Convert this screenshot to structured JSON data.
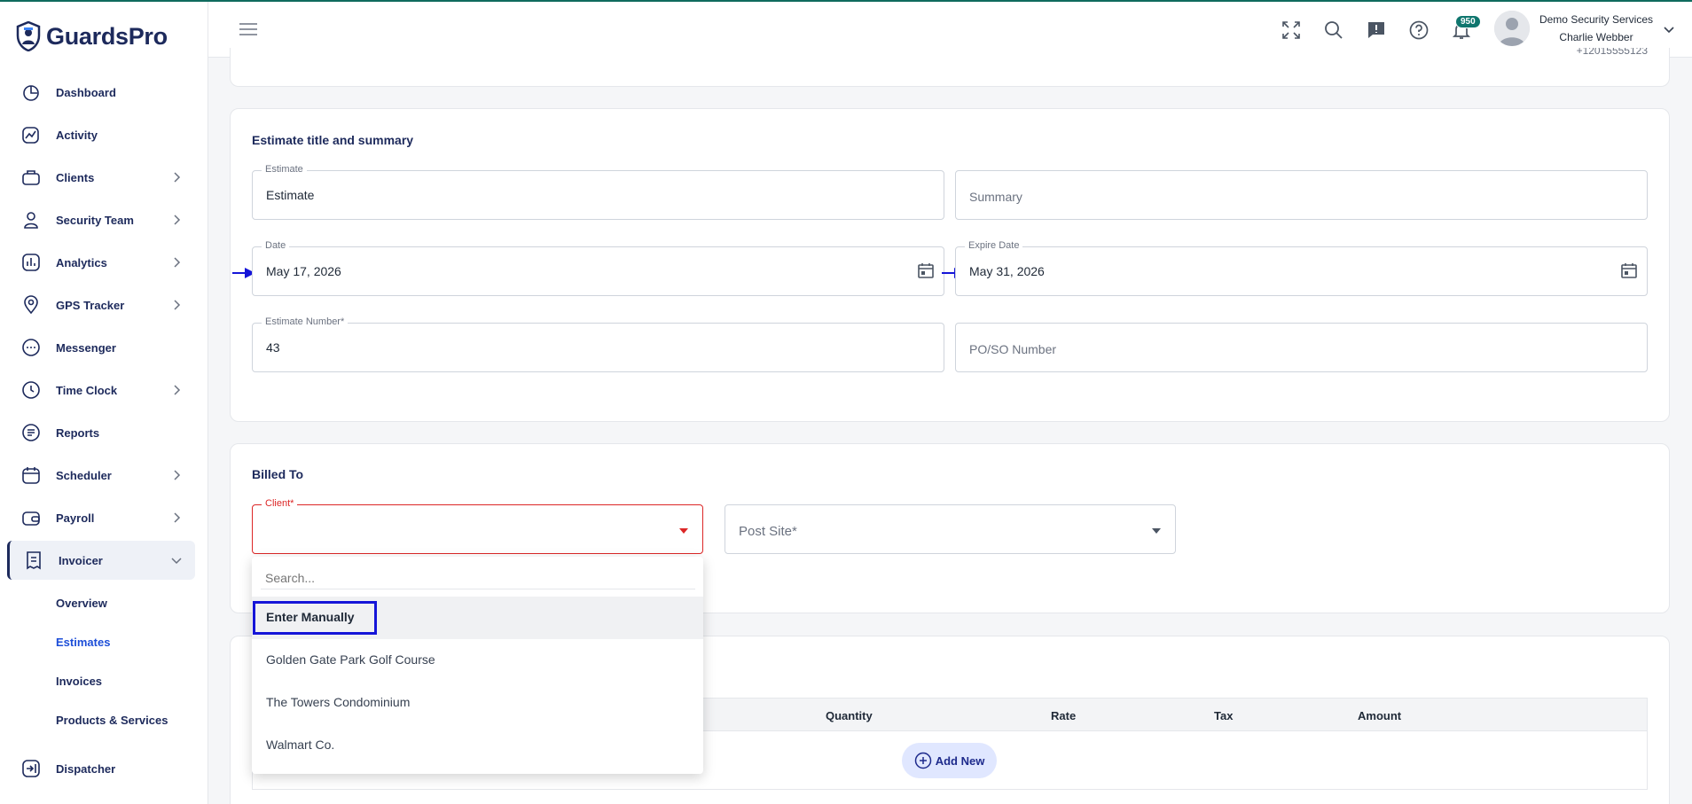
{
  "app": {
    "name": "GuardsPro"
  },
  "sidebar": {
    "items": [
      {
        "label": "Dashboard",
        "icon": "dashboard-icon"
      },
      {
        "label": "Activity",
        "icon": "activity-icon"
      },
      {
        "label": "Clients",
        "icon": "clients-icon"
      },
      {
        "label": "Security Team",
        "icon": "security-team-icon"
      },
      {
        "label": "Analytics",
        "icon": "analytics-icon"
      },
      {
        "label": "GPS Tracker",
        "icon": "gps-pin-icon"
      },
      {
        "label": "Messenger",
        "icon": "messenger-icon"
      },
      {
        "label": "Time Clock",
        "icon": "clock-icon"
      },
      {
        "label": "Reports",
        "icon": "reports-icon"
      },
      {
        "label": "Scheduler",
        "icon": "calendar-icon"
      },
      {
        "label": "Payroll",
        "icon": "wallet-icon"
      },
      {
        "label": "Invoicer",
        "icon": "invoice-icon"
      },
      {
        "label": "Dispatcher",
        "icon": "dispatcher-icon"
      }
    ],
    "invoicer_sub": [
      {
        "label": "Overview"
      },
      {
        "label": "Estimates"
      },
      {
        "label": "Invoices"
      },
      {
        "label": "Products & Services"
      }
    ]
  },
  "header": {
    "notification_count": "950",
    "user_company": "Demo Security Services",
    "user_name": "Charlie Webber"
  },
  "top_card": {
    "partial_text": "+12015555123"
  },
  "estimate_section": {
    "title": "Estimate title and summary",
    "estimate_label": "Estimate",
    "estimate_value": "Estimate",
    "summary_placeholder": "Summary",
    "date_label": "Date",
    "date_value": "May 17, 2026",
    "expire_label": "Expire Date",
    "expire_value": "May 31, 2026",
    "number_label": "Estimate Number*",
    "number_value": "43",
    "po_placeholder": "PO/SO Number"
  },
  "billed_to": {
    "title": "Billed To",
    "client_label": "Client*",
    "post_site_placeholder": "Post Site*"
  },
  "client_dropdown": {
    "search_placeholder": "Search...",
    "options": [
      "Enter Manually",
      "Golden Gate Park Golf Course",
      "The Towers Condominium",
      "Walmart Co."
    ]
  },
  "items_table": {
    "columns": [
      "Quantity",
      "Rate",
      "Tax",
      "Amount"
    ],
    "add_new_label": "Add New"
  },
  "colors": {
    "brand": "#1d2a5c",
    "accent_active": "#1d4ed8",
    "error": "#dc2626",
    "badge": "#0f766e",
    "annotation": "#1515d8"
  }
}
